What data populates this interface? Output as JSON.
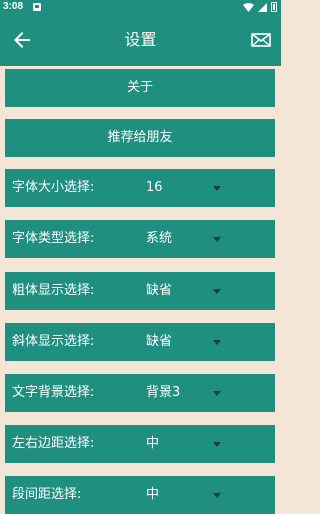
{
  "status_bar": {
    "time": "3:08"
  },
  "header": {
    "title": "设置"
  },
  "buttons": {
    "about": "关于",
    "recommend": "推荐给朋友"
  },
  "settings": [
    {
      "label": "字体大小选择:",
      "value": "16"
    },
    {
      "label": "字体类型选择:",
      "value": "系统"
    },
    {
      "label": "粗体显示选择:",
      "value": "缺省"
    },
    {
      "label": "斜体显示选择:",
      "value": "缺省"
    },
    {
      "label": "文字背景选择:",
      "value": "背景3"
    },
    {
      "label": "左右边距选择:",
      "value": "中"
    },
    {
      "label": "段间距选择:",
      "value": "中"
    }
  ],
  "colors": {
    "primary": "#1f8f7f",
    "background": "#f3e6d6",
    "arrow": "#1a3f3a"
  }
}
